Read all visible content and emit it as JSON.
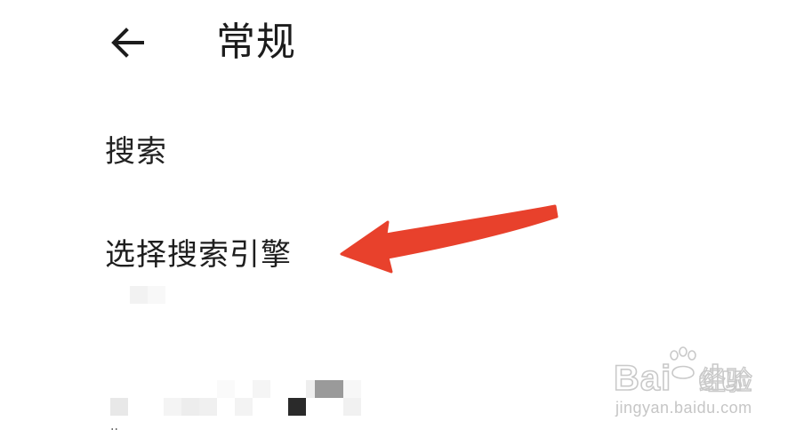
{
  "app_bar": {
    "title": "常规",
    "back_icon": "arrow-left-icon"
  },
  "settings": {
    "section_header": "搜索",
    "items": [
      {
        "title": "选择搜索引擎",
        "summary_redacted": true
      }
    ]
  },
  "annotation": {
    "arrow_color": "#e8412c",
    "arrow_icon": "red-arrow-pointing-left"
  },
  "colors": {
    "background": "#ffffff",
    "text_primary": "#1f1f1f"
  }
}
